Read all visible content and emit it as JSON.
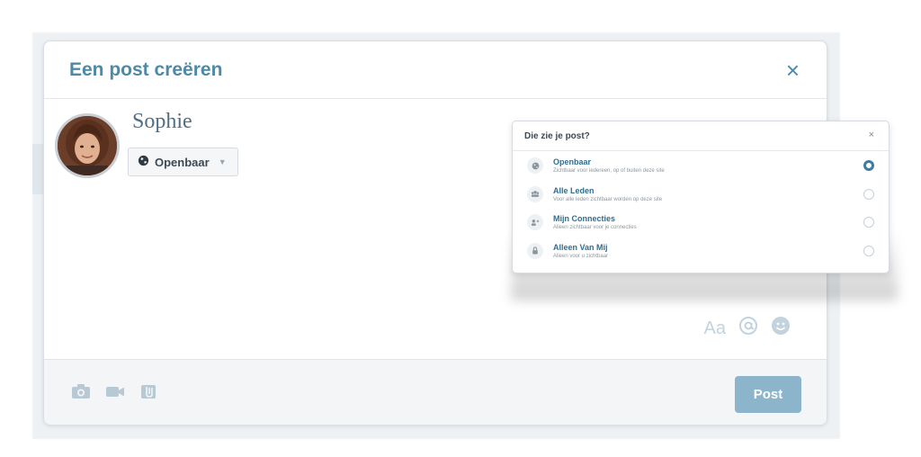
{
  "modal": {
    "title": "Een post creëren",
    "close": "×"
  },
  "user": {
    "name": "Sophie",
    "privacy_selected": "Openbaar"
  },
  "tools": {
    "text_format": "Aa",
    "mention": "@",
    "emoji": "☻"
  },
  "footer": {
    "post_label": "Post",
    "icons": [
      "camera-icon",
      "video-icon",
      "attachment-icon"
    ]
  },
  "privacy_popover": {
    "title": "Die zie je post?",
    "close": "×",
    "selected_index": 0,
    "options": [
      {
        "label": "Openbaar",
        "description": "Zichtbaar voor iedereen, op of buiten deze site",
        "icon": "globe-icon"
      },
      {
        "label": "Alle Leden",
        "description": "Voor alle leden zichtbaar worden op deze site",
        "icon": "members-icon"
      },
      {
        "label": "Mijn Connecties",
        "description": "Alleen zichtbaar voor je connecties",
        "icon": "connections-icon"
      },
      {
        "label": "Alleen Van Mij",
        "description": "Alleen voor u zichtbaar",
        "icon": "lock-icon"
      }
    ]
  },
  "colors": {
    "accent": "#4d8aa8",
    "post_button": "#8cb5cc",
    "radio_checked": "#3f7da0"
  }
}
